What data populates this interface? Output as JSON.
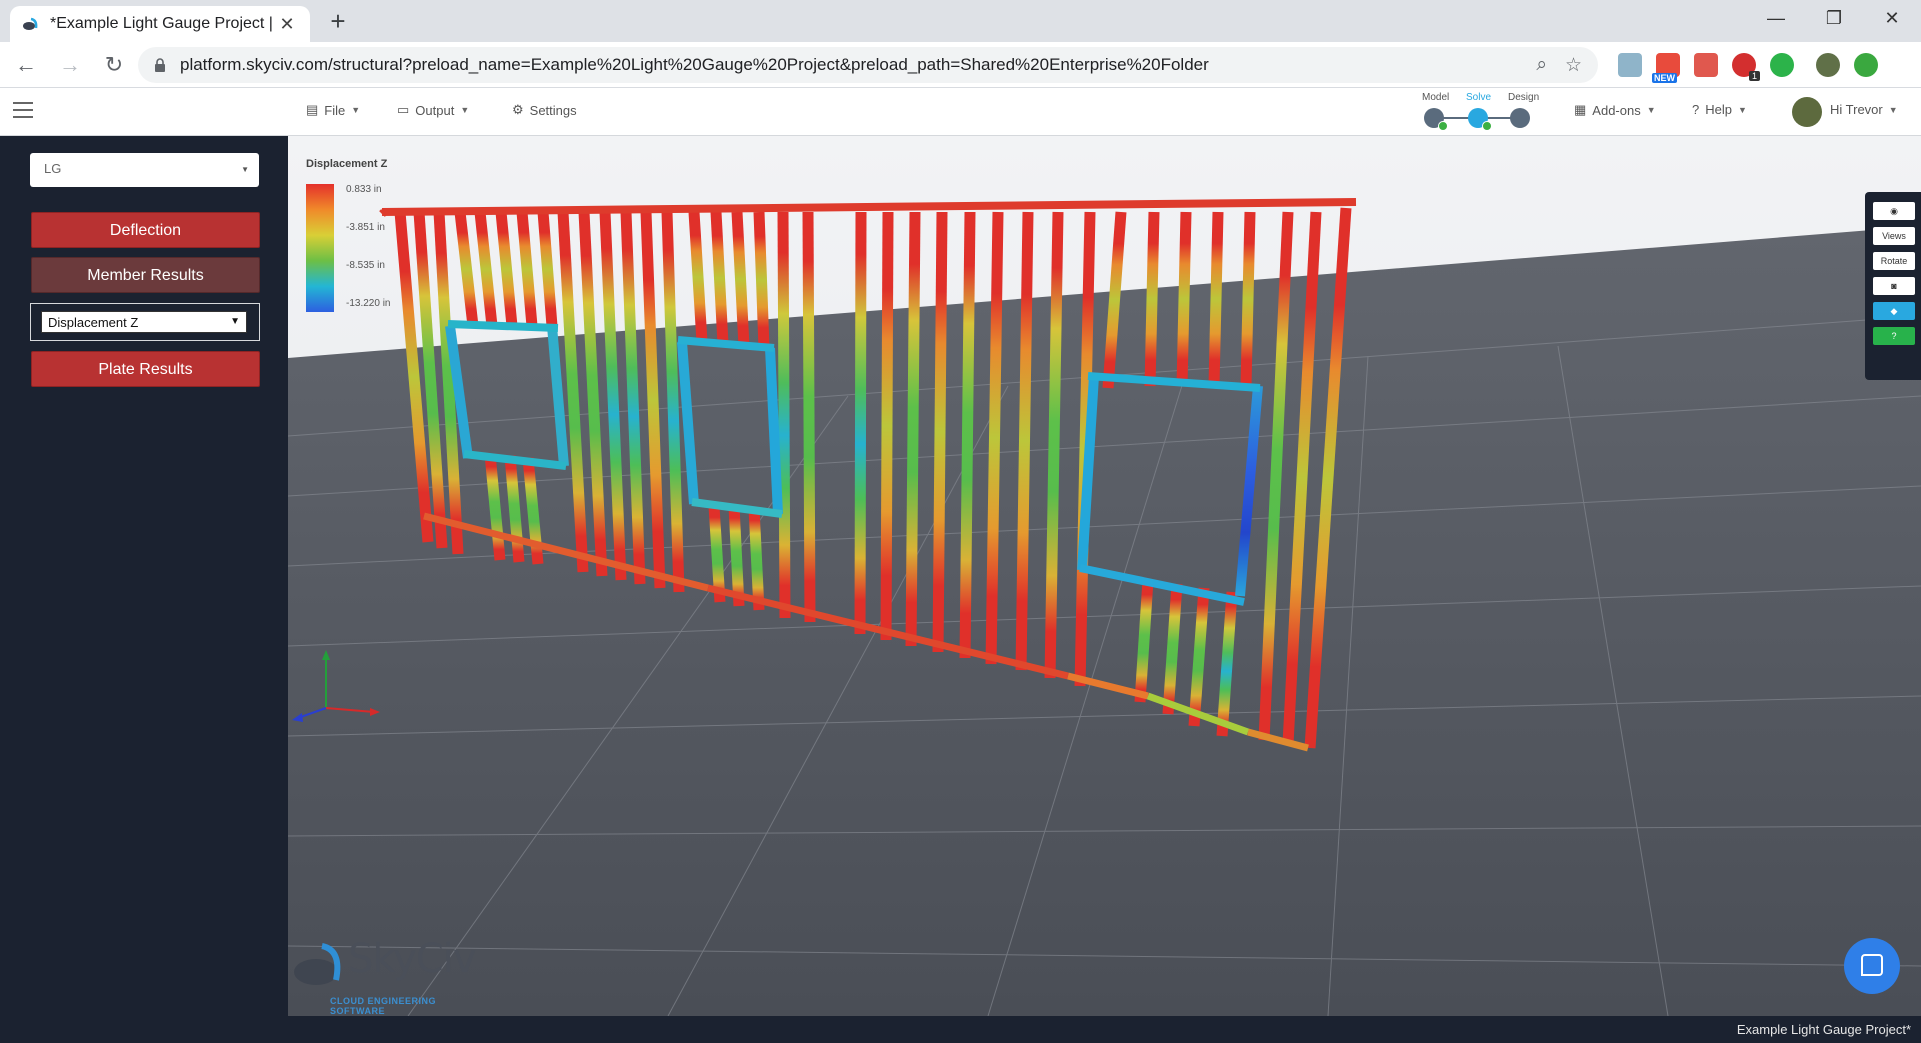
{
  "browser": {
    "tab_title": "*Example Light Gauge Project | S",
    "tab_close": "✕",
    "new_tab": "+",
    "url": "platform.skyciv.com/structural?preload_name=Example%20Light%20Gauge%20Project&preload_path=Shared%20Enterprise%20Folder",
    "ext_new_badge": "NEW",
    "ext_count_badge": "1",
    "window_minimize": "—",
    "window_restore": "❐",
    "window_close": "✕"
  },
  "header": {
    "menu": [
      {
        "label": "File",
        "icon": "file-icon"
      },
      {
        "label": "Output",
        "icon": "monitor-icon"
      },
      {
        "label": "Settings",
        "icon": "gear-icon"
      }
    ],
    "modes": {
      "model": "Model",
      "solve": "Solve",
      "design": "Design",
      "active": "Solve"
    },
    "addons": "Add-ons",
    "help": "Help",
    "user": "Hi Trevor"
  },
  "sidebar": {
    "lg_select": "LG",
    "deflection": "Deflection",
    "member_results": "Member Results",
    "result_type": "Displacement Z",
    "plate_results": "Plate Results"
  },
  "legend": {
    "title": "Displacement Z",
    "max": "0.833 in",
    "v2": "-3.851 in",
    "v3": "-8.535 in",
    "min": "-13.220 in"
  },
  "tools": {
    "views": "Views",
    "rotate": "Rotate",
    "view_icon": "eye-icon",
    "screenshot_icon": "camera-icon",
    "cube_icon": "cube-icon",
    "help_icon": "question-icon"
  },
  "logo": {
    "name": "SkyCiv",
    "tagline": "CLOUD ENGINEERING SOFTWARE"
  },
  "footer": {
    "project": "Example Light Gauge Project*"
  },
  "colors": {
    "sidebar_bg": "#1b2230",
    "button_red": "#b83232",
    "button_dark": "#6b3a3c",
    "accent_blue": "#29a8e0",
    "floor": "#50545c",
    "sky": "#eef0f2"
  }
}
